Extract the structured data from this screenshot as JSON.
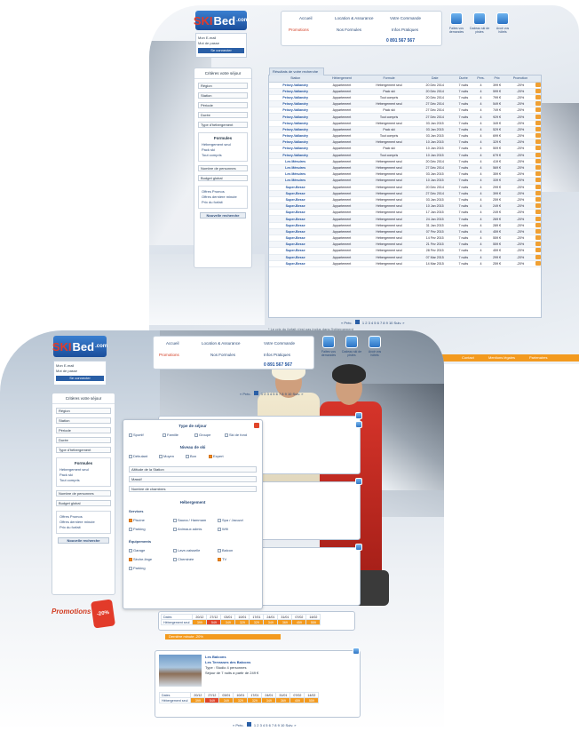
{
  "brand": {
    "ski": "SKI",
    "bed": "Bed",
    "com": ".com"
  },
  "login": {
    "line1": "Mon E-mail",
    "line2": "Mot de passe",
    "button": "Se connecter"
  },
  "nav": {
    "tabs": [
      "Accueil",
      "Location & Assurance",
      "Votre Commande",
      "Promotions",
      "Nos Formules",
      "Infos Pratiques"
    ],
    "phone": "0 891 567 567",
    "icons": [
      {
        "label": "Faites vos demandes",
        "icon": "globe-icon"
      },
      {
        "label": "Cadeau ski de pistes",
        "icon": "gift-icon"
      },
      {
        "label": "Avoir vos hôtels",
        "icon": "check-icon"
      }
    ]
  },
  "sidebar": {
    "title": "Critères votre séjour",
    "selects": [
      "Région",
      "Station",
      "Période",
      "Durée",
      "Type d'hébergement"
    ],
    "formulas_title": "Formules",
    "formulas": [
      "Hébergement seul",
      "Pack ski",
      "Tout compris"
    ],
    "selects2": [
      "Nombre de personnes",
      "Budget global"
    ],
    "offers": [
      "Offres Promos",
      "Offres dernière minute",
      "Prix du forfait"
    ],
    "search_button": "Nouvelle recherche"
  },
  "results": {
    "tab_label": "Résultats de votre recherche",
    "columns": [
      "Station",
      "Hébergement",
      "Formule",
      "Date",
      "Durée",
      "Pers.",
      "Prix",
      "Promotion"
    ],
    "rows": [
      [
        "Peisey-Vallandry",
        "Appartement",
        "Hébergement seul",
        "20 Déc 2014",
        "7 nuits",
        "4",
        "399 €",
        "-20%"
      ],
      [
        "Peisey-Vallandry",
        "Appartement",
        "Pack ski",
        "20 Déc 2014",
        "7 nuits",
        "4",
        "599 €",
        "-20%"
      ],
      [
        "Peisey-Vallandry",
        "Appartement",
        "Tout compris",
        "20 Déc 2014",
        "7 nuits",
        "4",
        "799 €",
        "-20%"
      ],
      [
        "Peisey-Vallandry",
        "Appartement",
        "Hébergement seul",
        "27 Déc 2014",
        "7 nuits",
        "4",
        "549 €",
        "-20%"
      ],
      [
        "Peisey-Vallandry",
        "Appartement",
        "Pack ski",
        "27 Déc 2014",
        "7 nuits",
        "4",
        "749 €",
        "-20%"
      ],
      [
        "Peisey-Vallandry",
        "Appartement",
        "Tout compris",
        "27 Déc 2014",
        "7 nuits",
        "4",
        "929 €",
        "-20%"
      ],
      [
        "Peisey-Vallandry",
        "Appartement",
        "Hébergement seul",
        "03 Jan 2015",
        "7 nuits",
        "4",
        "349 €",
        "-20%"
      ],
      [
        "Peisey-Vallandry",
        "Appartement",
        "Pack ski",
        "03 Jan 2015",
        "7 nuits",
        "4",
        "529 €",
        "-20%"
      ],
      [
        "Peisey-Vallandry",
        "Appartement",
        "Tout compris",
        "03 Jan 2015",
        "7 nuits",
        "4",
        "699 €",
        "-20%"
      ],
      [
        "Peisey-Vallandry",
        "Appartement",
        "Hébergement seul",
        "10 Jan 2015",
        "7 nuits",
        "4",
        "329 €",
        "-20%"
      ],
      [
        "Peisey-Vallandry",
        "Appartement",
        "Pack ski",
        "10 Jan 2015",
        "7 nuits",
        "4",
        "509 €",
        "-20%"
      ],
      [
        "Peisey-Vallandry",
        "Appartement",
        "Tout compris",
        "10 Jan 2015",
        "7 nuits",
        "4",
        "679 €",
        "-20%"
      ],
      [
        "Les Ménuires",
        "Appartement",
        "Hébergement seul",
        "20 Déc 2014",
        "7 nuits",
        "4",
        "419 €",
        "-20%"
      ],
      [
        "Les Ménuires",
        "Appartement",
        "Hébergement seul",
        "27 Déc 2014",
        "7 nuits",
        "4",
        "569 €",
        "-20%"
      ],
      [
        "Les Ménuires",
        "Appartement",
        "Hébergement seul",
        "03 Jan 2015",
        "7 nuits",
        "4",
        "359 €",
        "-20%"
      ],
      [
        "Les Ménuires",
        "Appartement",
        "Hébergement seul",
        "10 Jan 2015",
        "7 nuits",
        "4",
        "339 €",
        "-20%"
      ],
      [
        "Super-Besse",
        "Appartement",
        "Hébergement seul",
        "20 Déc 2014",
        "7 nuits",
        "4",
        "299 €",
        "-20%"
      ],
      [
        "Super-Besse",
        "Appartement",
        "Hébergement seul",
        "27 Déc 2014",
        "7 nuits",
        "4",
        "399 €",
        "-20%"
      ],
      [
        "Super-Besse",
        "Appartement",
        "Hébergement seul",
        "03 Jan 2015",
        "7 nuits",
        "4",
        "259 €",
        "-20%"
      ],
      [
        "Super-Besse",
        "Appartement",
        "Hébergement seul",
        "10 Jan 2015",
        "7 nuits",
        "4",
        "249 €",
        "-20%"
      ],
      [
        "Super-Besse",
        "Appartement",
        "Hébergement seul",
        "17 Jan 2015",
        "7 nuits",
        "4",
        "249 €",
        "-20%"
      ],
      [
        "Super-Besse",
        "Appartement",
        "Hébergement seul",
        "24 Jan 2015",
        "7 nuits",
        "4",
        "269 €",
        "-20%"
      ],
      [
        "Super-Besse",
        "Appartement",
        "Hébergement seul",
        "31 Jan 2015",
        "7 nuits",
        "4",
        "289 €",
        "-20%"
      ],
      [
        "Super-Besse",
        "Appartement",
        "Hébergement seul",
        "07 Fév 2015",
        "7 nuits",
        "4",
        "459 €",
        "-20%"
      ],
      [
        "Super-Besse",
        "Appartement",
        "Hébergement seul",
        "14 Fév 2015",
        "7 nuits",
        "4",
        "559 €",
        "-20%"
      ],
      [
        "Super-Besse",
        "Appartement",
        "Hébergement seul",
        "21 Fév 2015",
        "7 nuits",
        "4",
        "559 €",
        "-20%"
      ],
      [
        "Super-Besse",
        "Appartement",
        "Hébergement seul",
        "28 Fév 2015",
        "7 nuits",
        "4",
        "459 €",
        "-20%"
      ],
      [
        "Super-Besse",
        "Appartement",
        "Hébergement seul",
        "07 Mar 2015",
        "7 nuits",
        "4",
        "299 €",
        "-20%"
      ],
      [
        "Super-Besse",
        "Appartement",
        "Hébergement seul",
        "14 Mar 2015",
        "7 nuits",
        "4",
        "259 €",
        "-20%"
      ]
    ],
    "pager_prev": "« Préc.",
    "pager_pages": "1 2 3 4 5 6 7 8 9 10",
    "pager_next": "Suiv. »",
    "footnote": "* Le prix du forfait n'est pas inclus dans l'hébergement"
  },
  "footer_links": [
    "Contact",
    "Mentions légales",
    "Partenaires"
  ],
  "popup": {
    "title": "Type de séjour",
    "types": [
      "Sportif",
      "Famille",
      "Groupe",
      "Ski de fond"
    ],
    "level_title": "Niveau de ski",
    "levels": [
      "Débutant",
      "Moyen",
      "Bon",
      "Expert"
    ],
    "selects": [
      "Altitude de la Station",
      "Massif",
      "Nombre de chambres"
    ],
    "lodging_title": "Hébergement",
    "services_title": "Services",
    "services": [
      "Piscine",
      "Sauna / Hammam",
      "Spa / Jacuzzi",
      "Parking",
      "Animaux admis",
      "Wifi"
    ],
    "equip_title": "Équipements",
    "equip": [
      "Garage",
      "Lave-vaisselle",
      "Balcon",
      "Sèche-linge",
      "Cheminée",
      "TV",
      "Parking"
    ]
  },
  "calendar": {
    "pager_prev": "« Préc.",
    "pager_pages": "1 2 3 4 5 6 7 8 9 10",
    "pager_next": "Suiv. »",
    "row1_label": "Dates",
    "row2_label": "Hébergement seul",
    "row1": [
      "20/12",
      "27/12",
      "03/01",
      "10/01",
      "17/01",
      "24/01",
      "31/01",
      "07/02",
      "14/02"
    ],
    "row2": [
      "399",
      "549",
      "349",
      "329",
      "329",
      "349",
      "369",
      "459",
      "559"
    ],
    "promo_band": "Dernière minute  -20%"
  },
  "promo_stamp": {
    "word": "Promotions",
    "badge": "-20%"
  },
  "hotel": {
    "name": "Les Balcons",
    "sub": "Les Terrasses des Balcons",
    "line1": "Type : Studio 4 personnes",
    "line2": "Séjour de 7 nuits à partir de 249 €"
  },
  "colors": {
    "accent": "#f39a1e",
    "brand_blue": "#1b4e9b",
    "brand_red": "#e23b2a"
  }
}
